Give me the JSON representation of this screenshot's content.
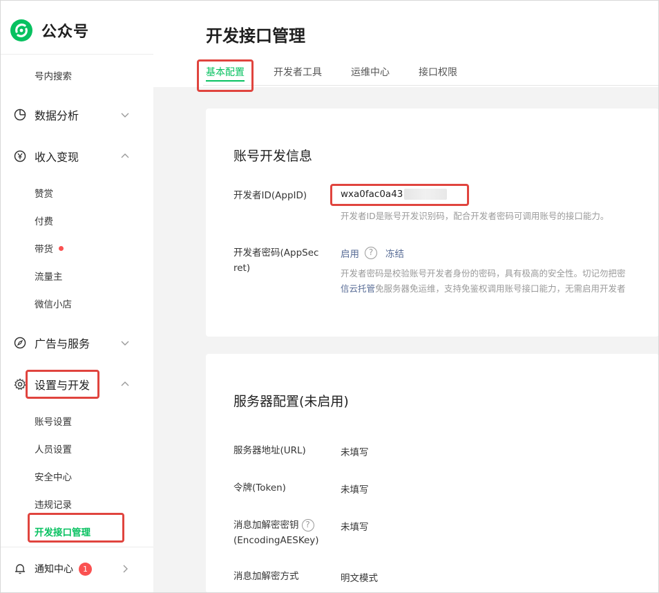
{
  "brand": {
    "name": "公众号"
  },
  "sidebar": {
    "top_item": "号内搜索",
    "data_analysis": "数据分析",
    "monetization": {
      "label": "收入变现",
      "items": [
        {
          "label": "赞赏"
        },
        {
          "label": "付费"
        },
        {
          "label": "带货"
        },
        {
          "label": "流量主"
        },
        {
          "label": "微信小店"
        }
      ]
    },
    "ads": "广告与服务",
    "settings": {
      "label": "设置与开发",
      "items": [
        {
          "label": "账号设置"
        },
        {
          "label": "人员设置"
        },
        {
          "label": "安全中心"
        },
        {
          "label": "违规记录"
        },
        {
          "label": "开发接口管理"
        }
      ]
    },
    "notifications": {
      "label": "通知中心",
      "badge": "1"
    }
  },
  "page": {
    "title": "开发接口管理",
    "tabs": [
      {
        "label": "基本配置"
      },
      {
        "label": "开发者工具"
      },
      {
        "label": "运维中心"
      },
      {
        "label": "接口权限"
      }
    ]
  },
  "dev_info": {
    "title": "账号开发信息",
    "appid_label": "开发者ID(AppID)",
    "appid_value": "wxa0fac0a43",
    "appid_desc": "开发者ID是账号开发识别码，配合开发者密码可调用账号的接口能力。",
    "secret_label_1": "开发者密码(AppSec",
    "secret_label_2": "ret)",
    "enable": "启用",
    "freeze": "冻结",
    "secret_desc_1": "开发者密码是校验账号开发者身份的密码，具有极高的安全性。切记勿把密",
    "secret_desc_2_link": "信云托管",
    "secret_desc_2": "免服务器免运维，支持免鉴权调用账号接口能力，无需启用开发者"
  },
  "server": {
    "title": "服务器配置(未启用)",
    "url_label": "服务器地址(URL)",
    "url_value": "未填写",
    "token_label": "令牌(Token)",
    "token_value": "未填写",
    "aes_label_1": "消息加解密密钥",
    "aes_label_2": "(EncodingAESKey)",
    "aes_value": "未填写",
    "mode_label": "消息加解密方式",
    "mode_value": "明文模式"
  },
  "colors": {
    "accent": "#07c160",
    "highlight": "#e0443e",
    "link": "#576b95",
    "badge": "#fa5151"
  }
}
